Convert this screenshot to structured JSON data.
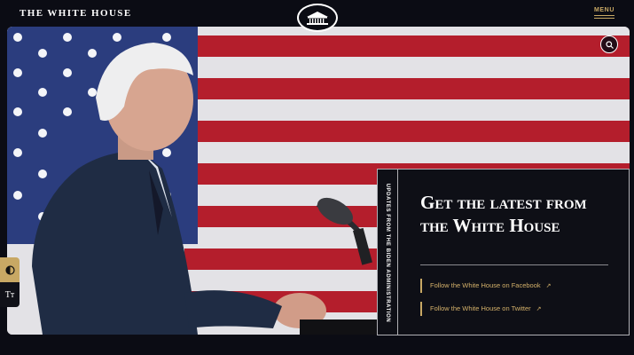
{
  "header": {
    "site_title": "THE WHITE HOUSE",
    "menu_label": "MENU"
  },
  "icons": {
    "seal": "white-house-seal-icon",
    "search": "search-icon",
    "contrast": "contrast-icon",
    "text_size": "text-size-icon",
    "external": "external-link-icon"
  },
  "accessibility": {
    "text_size_label": "Tт"
  },
  "promo": {
    "rail_label": "UPDATES FROM THE BIDEN ADMINISTRATION",
    "title": "Get the latest from the White House",
    "links": [
      {
        "label": "Follow the White House on Facebook",
        "arrow": "↗"
      },
      {
        "label": "Follow the White House on Twitter",
        "arrow": "↗"
      }
    ]
  },
  "colors": {
    "background": "#0b0c14",
    "accent_gold": "#c8a864",
    "flag_red": "#b41e2c",
    "flag_blue": "#2b3d7e",
    "suit_navy": "#1f2c44"
  }
}
